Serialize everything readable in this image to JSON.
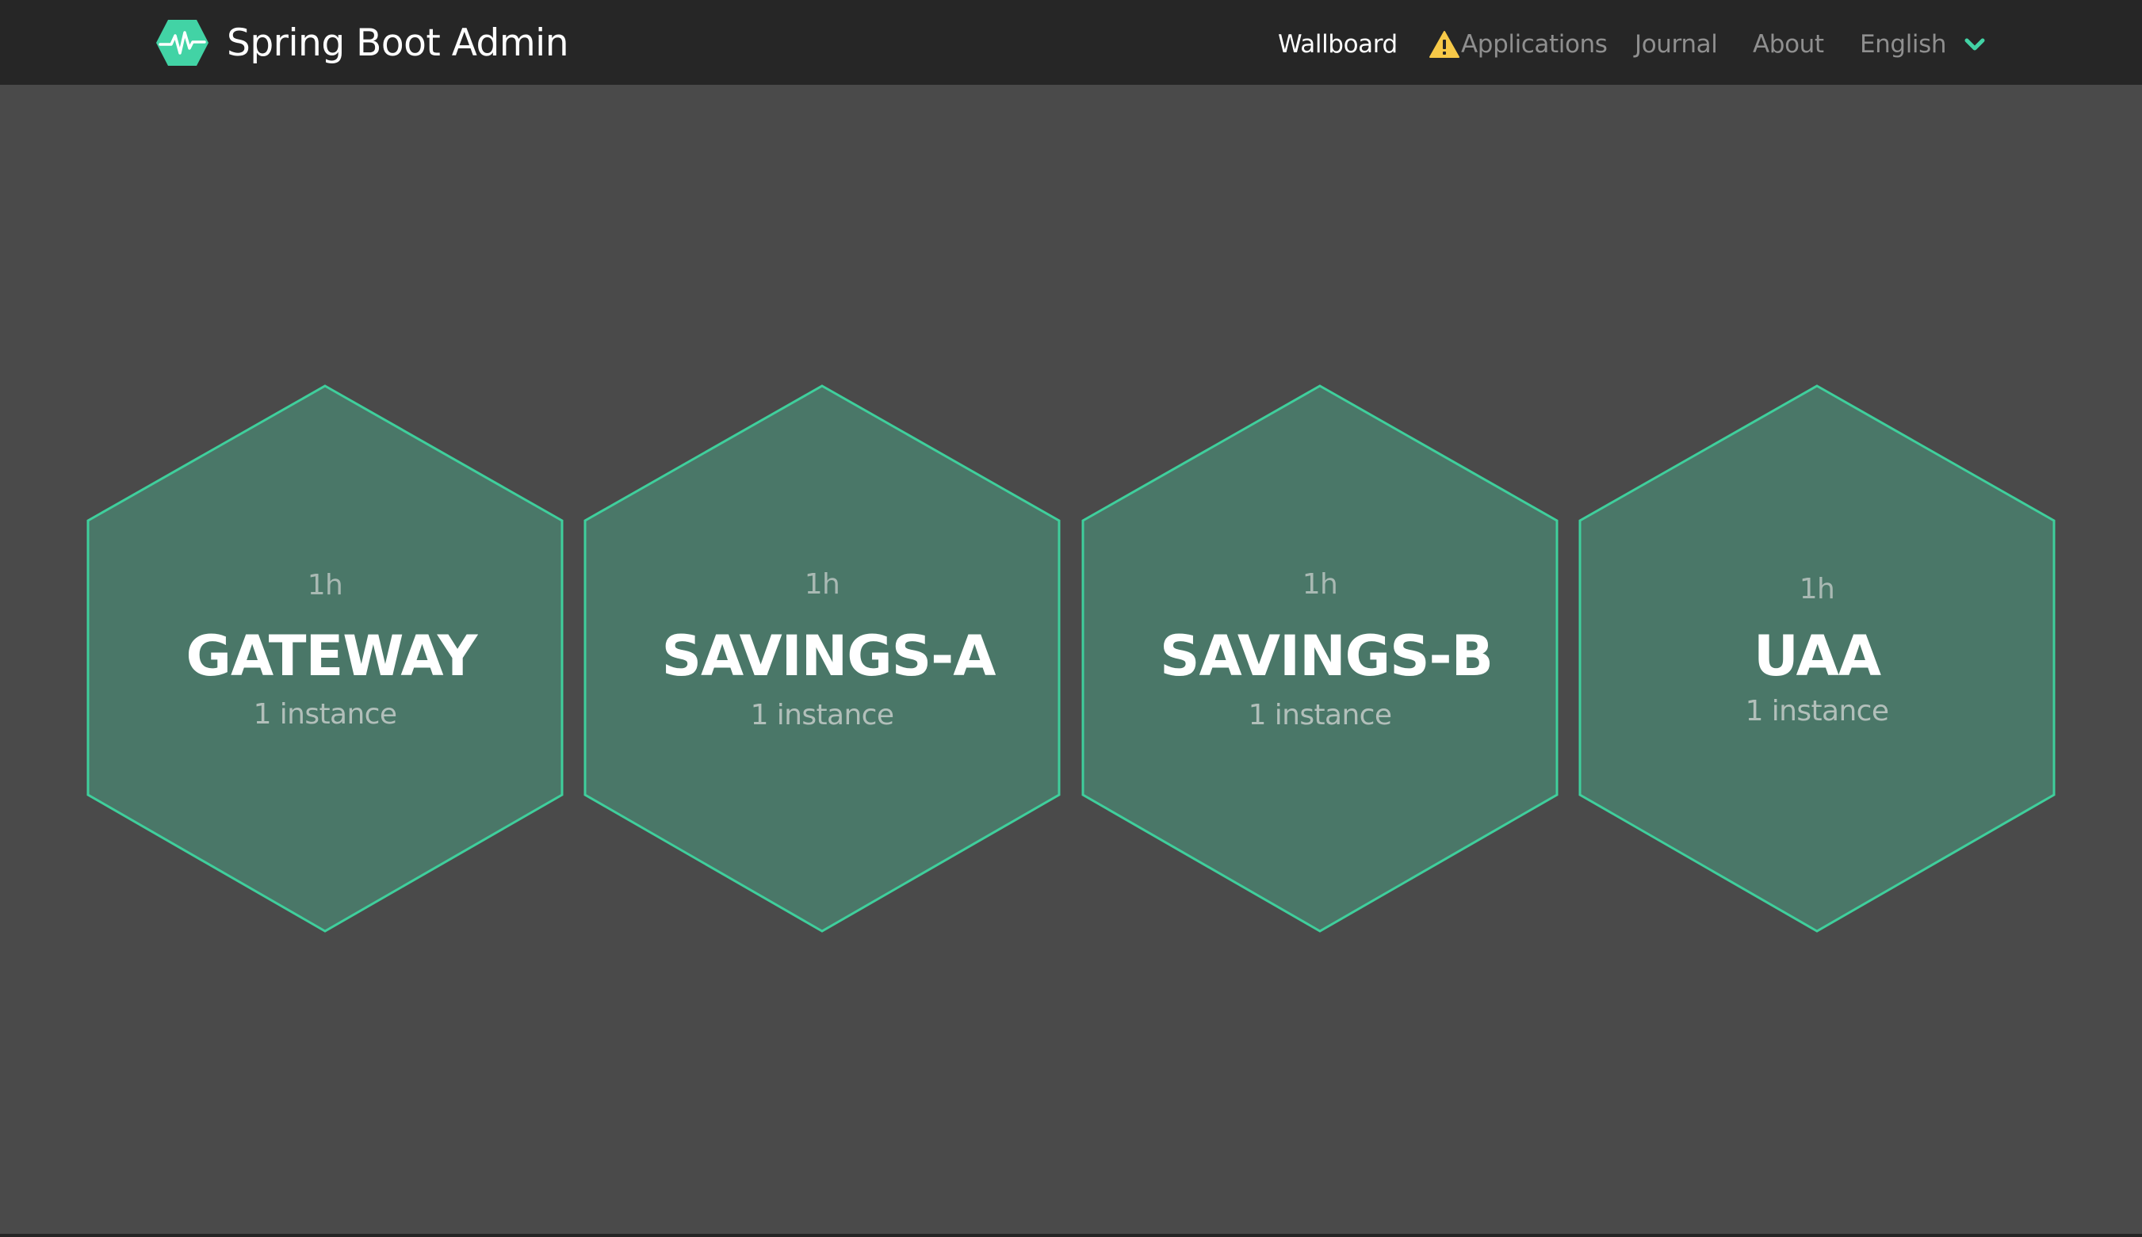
{
  "header": {
    "title": "Spring Boot Admin",
    "logo_icon": "heartbeat-hexagon-icon",
    "accent_color": "#42d3a5",
    "nav": {
      "wallboard": "Wallboard",
      "applications": "Applications",
      "journal": "Journal",
      "about": "About",
      "language": "English"
    },
    "applications_warning_icon": "warning-triangle-icon",
    "language_dropdown_icon": "chevron-down-icon"
  },
  "wallboard": {
    "applications": [
      {
        "uptime": "1h",
        "name": "GATEWAY",
        "instances": "1 instance"
      },
      {
        "uptime": "1h",
        "name": "SAVINGS-A",
        "instances": "1 instance"
      },
      {
        "uptime": "1h",
        "name": "SAVINGS-B",
        "instances": "1 instance"
      },
      {
        "uptime": "1h",
        "name": "UAA",
        "instances": "1 instance"
      }
    ],
    "tile_fill_color": "#4a7768",
    "tile_border_color": "#3fcf9c"
  }
}
